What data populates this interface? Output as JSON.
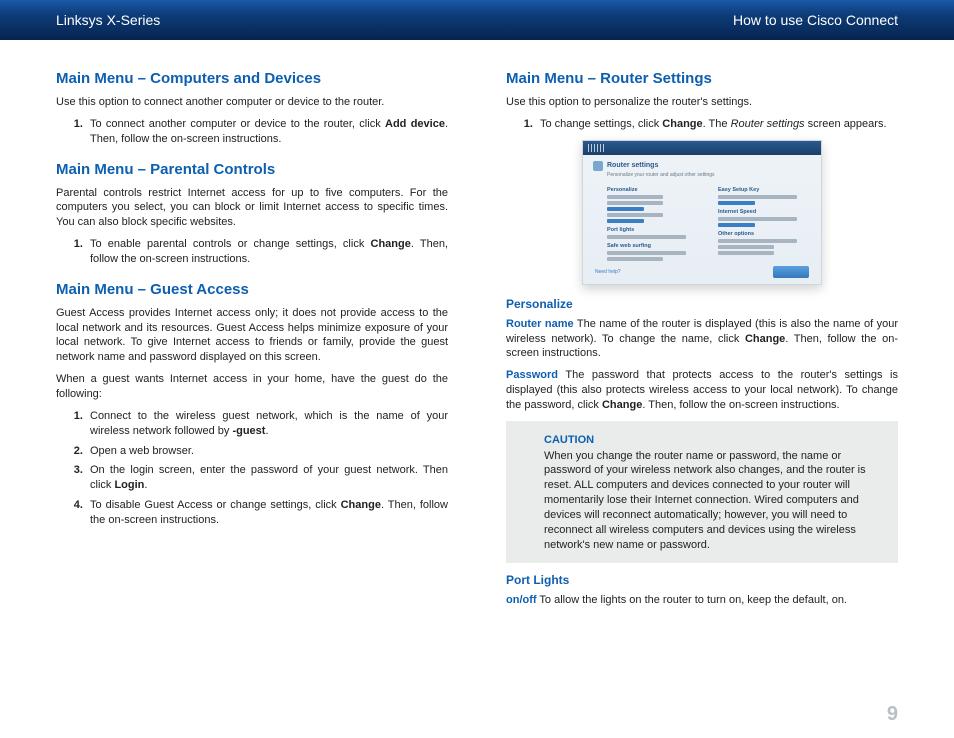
{
  "header": {
    "left": "Linksys X-Series",
    "right": "How to use Cisco Connect"
  },
  "left_col": {
    "s1": {
      "title": "Main Menu – Computers and Devices",
      "intro": "Use this option to connect another computer or device to the router.",
      "item1_a": "To connect another computer or device to the router, click ",
      "item1_b": "Add device",
      "item1_c": ". Then, follow the on-screen instructions."
    },
    "s2": {
      "title": "Main Menu – Parental Controls",
      "intro": "Parental controls restrict Internet access for up to five computers. For the computers you select, you can block or limit Internet access to specific times. You can also block specific websites.",
      "item1_a": "To enable parental controls or change settings, click ",
      "item1_b": "Change",
      "item1_c": ". Then, follow the on-screen instructions."
    },
    "s3": {
      "title": "Main Menu – Guest Access",
      "intro": "Guest Access provides Internet access only; it does not provide access to the local network and its resources. Guest Access helps minimize exposure of your local network. To give Internet access to friends or family, provide the guest network name and password displayed on this screen.",
      "p2": "When a guest wants Internet access in your home, have the guest do the following:",
      "item1_a": "Connect to the wireless guest network, which is the name of your wireless network followed by ",
      "item1_b": "-guest",
      "item1_c": ".",
      "item2": "Open a web browser.",
      "item3_a": "On the login screen, enter the password of your guest network. Then click ",
      "item3_b": "Login",
      "item3_c": ".",
      "item4_a": "To disable Guest Access or change settings, click ",
      "item4_b": "Change",
      "item4_c": ". Then, follow the on-screen instructions."
    }
  },
  "right_col": {
    "s1": {
      "title": "Main Menu – Router Settings",
      "intro": "Use this option to personalize the router's settings.",
      "item1_a": "To change settings, click ",
      "item1_b": "Change",
      "item1_c": ". The ",
      "item1_d": "Router settings",
      "item1_e": " screen appears."
    },
    "ss": {
      "title": "Router settings",
      "l1": "Personalize",
      "l2": "Easy Setup Key",
      "l3": "Port lights",
      "l4": "Internet Speed",
      "l5": "Safe web surfing",
      "l6": "Other options"
    },
    "s2": {
      "title": "Personalize",
      "rn_label": "Router name",
      "rn_text_a": "  The name of the router is displayed (this is also the name of your wireless network). To change the name, click ",
      "rn_text_b": "Change",
      "rn_text_c": ". Then, follow the on-screen instructions.",
      "pw_label": "Password",
      "pw_text_a": " The password that protects access to the router's settings is displayed (this also protects wireless access to your local network). To change the password, click ",
      "pw_text_b": "Change",
      "pw_text_c": ". Then, follow the on-screen instructions."
    },
    "caution": {
      "title": "CAUTION",
      "body": "When you change the router name or password, the name or password of your wireless network also changes, and the router is reset. ALL computers and devices connected to your router will momentarily lose their Internet connection. Wired computers and devices will reconnect automatically; however, you will need to reconnect all wireless computers and devices using the wireless network's new name or password."
    },
    "s3": {
      "title": "Port Lights",
      "onoff_label": "on/off",
      "onoff_text": "   To allow the lights on the router to turn on, keep the default, on."
    }
  },
  "page_number": "9"
}
